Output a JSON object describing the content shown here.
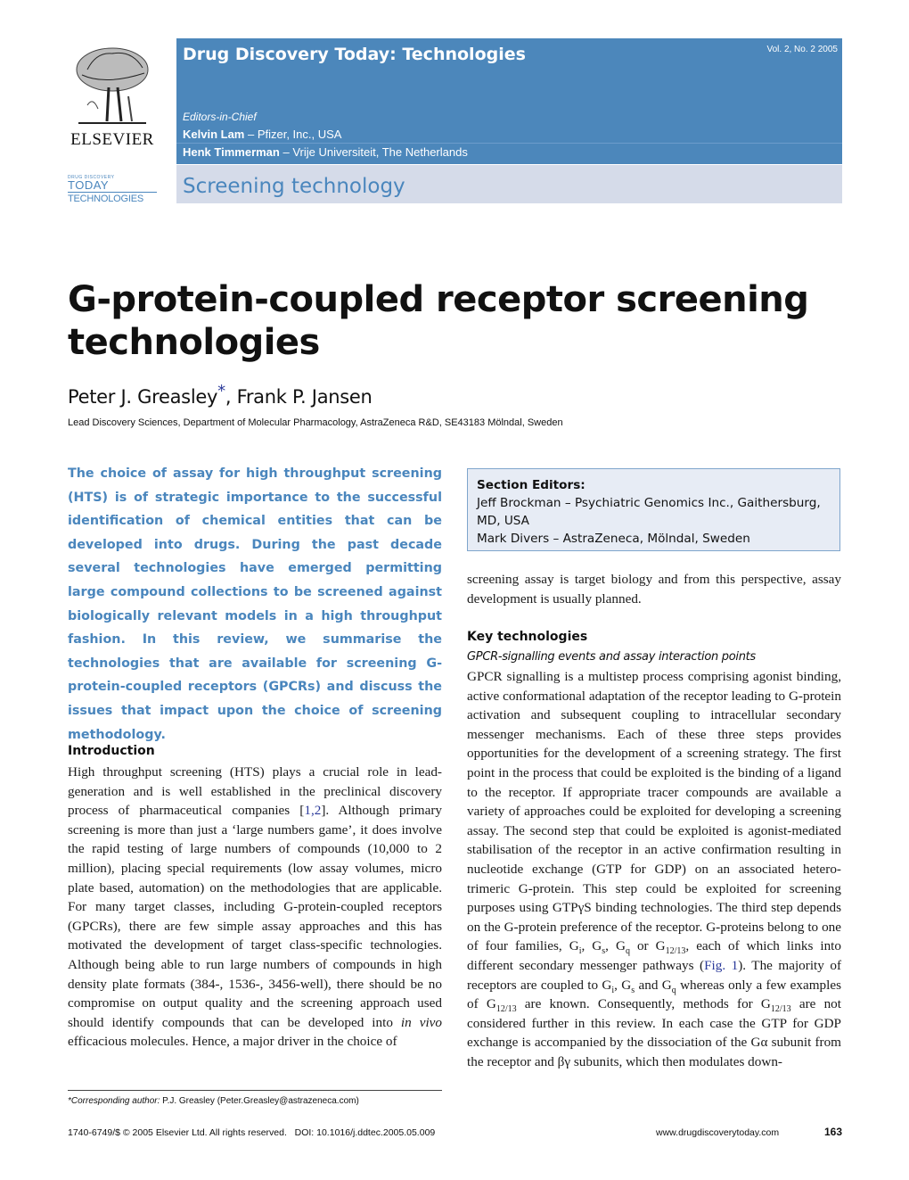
{
  "header": {
    "publisher": "ELSEVIER",
    "ddt_logo": {
      "small": "DRUG DISCOVERY",
      "today": "TODAY",
      "technologies": "TECHNOLOGIES"
    },
    "journal_title": "Drug Discovery Today: Technologies",
    "volume": "Vol. 2, No. 2 2005",
    "editors_label": "Editors-in-Chief",
    "editors": [
      {
        "name": "Kelvin Lam",
        "affiliation": " – Pfizer, Inc., USA"
      },
      {
        "name": "Henk Timmerman",
        "affiliation": " – Vrije Universiteit, The Netherlands"
      }
    ],
    "section": "Screening technology"
  },
  "article": {
    "title": "G-protein-coupled receptor screening technologies",
    "author_1": "Peter J. Greasley",
    "author_star": "*",
    "author_2": ", Frank P. Jansen",
    "affiliation": "Lead Discovery Sciences, Department of Molecular Pharmacology, AstraZeneca R&D, SE43183 Mölndal, Sweden",
    "abstract": "The choice of assay for high throughput screening (HTS) is of strategic importance to the successful identification of chemical entities that can be developed into drugs. During the past decade several technologies have emerged permitting large compound collections to be screened against biologically relevant models in a high throughput fashion. In this review, we summarise the technologies that are available for screening G-protein-coupled receptors (GPCRs) and discuss the issues that impact upon the choice of screening methodology."
  },
  "section_editors": {
    "heading": "Section Editors:",
    "lines": [
      "Jeff Brockman – Psychiatric Genomics Inc., Gaithersburg, MD, USA",
      "Mark Divers – AstraZeneca, Mölndal, Sweden"
    ]
  },
  "introduction": {
    "heading": "Introduction",
    "p1_a": "High throughput screening (HTS) plays a crucial role in lead-generation and is well established in the preclinical discovery process of pharmaceutical companies [",
    "ref_1": "1,2",
    "p1_b": "]. Although primary screening is more than just a ‘large numbers game’, it does involve the rapid testing of large numbers of compounds (10,000 to 2 million), placing special requirements (low assay volumes, micro plate based, automation) on the methodologies that are applicable. For many target classes, including G-protein-coupled receptors (GPCRs), there are few simple assay approaches and this has motivated the development of target class-specific technologies. Although being able to run large numbers of compounds in high density plate formats (384-, 1536-, 3456-well), there should be no compromise on output quality and the screening approach used should identify compounds that can be developed into ",
    "p1_italic": "in vivo",
    "p1_c": " efficacious molecules. Hence, a major driver in the choice of",
    "continued": "screening assay is target biology and from this perspective, assay development is usually planned."
  },
  "key_technologies": {
    "heading": "Key technologies",
    "subheading": "GPCR-signalling events and assay interaction points",
    "t1": "GPCR signalling is a multistep process comprising agonist binding, active conformational adaptation of the receptor leading to G-protein activation and subsequent coupling to intracellular secondary messenger mechanisms. Each of these three steps provides opportunities for the development of a screening strategy. The first point in the process that could be exploited is the binding of a ligand to the receptor. If appropriate tracer compounds are available a variety of approaches could be exploited for developing a screening assay. The second step that could be exploited is agonist-mediated stabilisation of the receptor in an active confirmation resulting in nucleotide exchange (GTP for GDP) on an associated hetero-trimeric G-protein. This step could be exploited for screening purposes using GTPγS binding technologies. The third step depends on the G-protein preference of the receptor. G-proteins belong to one of four families, G",
    "sub_i": "i",
    "t2": ", G",
    "sub_s": "s",
    "t3": ", G",
    "sub_q": "q",
    "t4": " or G",
    "sub_1213": "12/13",
    "t5": ", each of which links into different secondary messenger pathways (",
    "fig_ref": "Fig. 1",
    "t6": "). The majority of receptors are coupled to G",
    "t7": ", G",
    "t8": " and G",
    "t9": " whereas only a few examples of G",
    "t10": " are known. Consequently, methods for G",
    "t11": " are not considered further in this review. In each case the GTP for GDP exchange is accompanied by the dissociation of the Gα subunit from the receptor and βγ subunits, which then modulates down-"
  },
  "footnote": {
    "label": "*Corresponding author:",
    "text": " P.J. Greasley (Peter.Greasley@astrazeneca.com)"
  },
  "footer": {
    "left": "1740-6749/$ © 2005 Elsevier Ltd. All rights reserved.   DOI: 10.1016/j.ddtec.2005.05.009",
    "url": "www.drugdiscoverytoday.com",
    "page": "163"
  }
}
